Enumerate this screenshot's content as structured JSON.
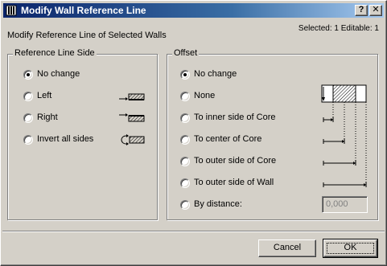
{
  "window": {
    "title": "Modify Wall Reference Line",
    "help_button": "?",
    "close_button": "✕"
  },
  "header": {
    "subtitle": "Modify Reference Line of Selected Walls",
    "selection_info": "Selected: 1 Editable: 1"
  },
  "reference_line_side": {
    "label": "Reference Line Side",
    "options": [
      {
        "label": "No change",
        "checked": true
      },
      {
        "label": "Left",
        "checked": false,
        "icon": "ref-left-icon"
      },
      {
        "label": "Right",
        "checked": false,
        "icon": "ref-right-icon"
      },
      {
        "label": "Invert all sides",
        "checked": false,
        "icon": "invert-sides-icon"
      }
    ]
  },
  "offset": {
    "label": "Offset",
    "options": [
      {
        "label": "No change",
        "checked": true
      },
      {
        "label": "None",
        "checked": false,
        "icon": "wall-section-icon"
      },
      {
        "label": "To inner side of Core",
        "checked": false
      },
      {
        "label": "To center of Core",
        "checked": false
      },
      {
        "label": "To outer side of Core",
        "checked": false
      },
      {
        "label": "To outer side of Wall",
        "checked": false
      },
      {
        "label": "By distance:",
        "checked": false
      }
    ],
    "distance_value": "0,000"
  },
  "buttons": {
    "cancel": "Cancel",
    "ok": "OK"
  },
  "colors": {
    "face": "#d4d0c8",
    "title_start": "#0a246a",
    "title_end": "#a6caf0"
  }
}
